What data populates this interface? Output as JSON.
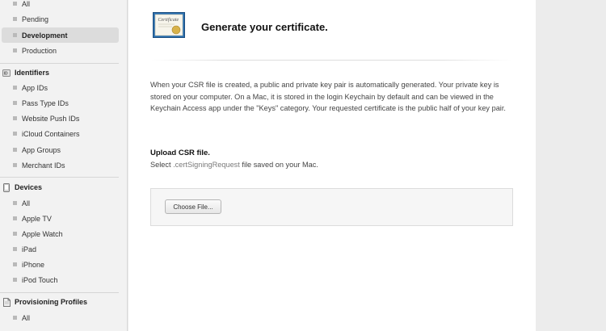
{
  "sidebar": {
    "certificates_items": [
      {
        "label": "All"
      },
      {
        "label": "Pending"
      },
      {
        "label": "Development",
        "selected": true
      },
      {
        "label": "Production"
      }
    ],
    "identifiers": {
      "title": "Identifiers",
      "icon": "id-icon",
      "items": [
        {
          "label": "App IDs"
        },
        {
          "label": "Pass Type IDs"
        },
        {
          "label": "Website Push IDs"
        },
        {
          "label": "iCloud Containers"
        },
        {
          "label": "App Groups"
        },
        {
          "label": "Merchant IDs"
        }
      ]
    },
    "devices": {
      "title": "Devices",
      "icon": "device-icon",
      "items": [
        {
          "label": "All"
        },
        {
          "label": "Apple TV"
        },
        {
          "label": "Apple Watch"
        },
        {
          "label": "iPad"
        },
        {
          "label": "iPhone"
        },
        {
          "label": "iPod Touch"
        }
      ]
    },
    "profiles": {
      "title": "Provisioning Profiles",
      "icon": "profile-icon",
      "items": [
        {
          "label": "All"
        }
      ]
    }
  },
  "main": {
    "title": "Generate your certificate.",
    "intro": "When your CSR file is created, a public and private key pair is automatically generated. Your private key is stored on your computer. On a Mac, it is stored in the login Keychain by default and can be viewed in the Keychain Access app under the \"Keys\" category. Your requested certificate is the public half of your key pair.",
    "upload_title": "Upload CSR file.",
    "upload_sub_prefix": "Select ",
    "upload_sub_ext": ".certSigningRequest",
    "upload_sub_suffix": " file saved on your Mac.",
    "choose_button": "Choose File..."
  },
  "colors": {
    "selected_bg": "#dcdcdc",
    "bullet": "#b9b9b9",
    "certificate_seal": "#d8b24a",
    "certificate_border": "#2a6fb0"
  }
}
